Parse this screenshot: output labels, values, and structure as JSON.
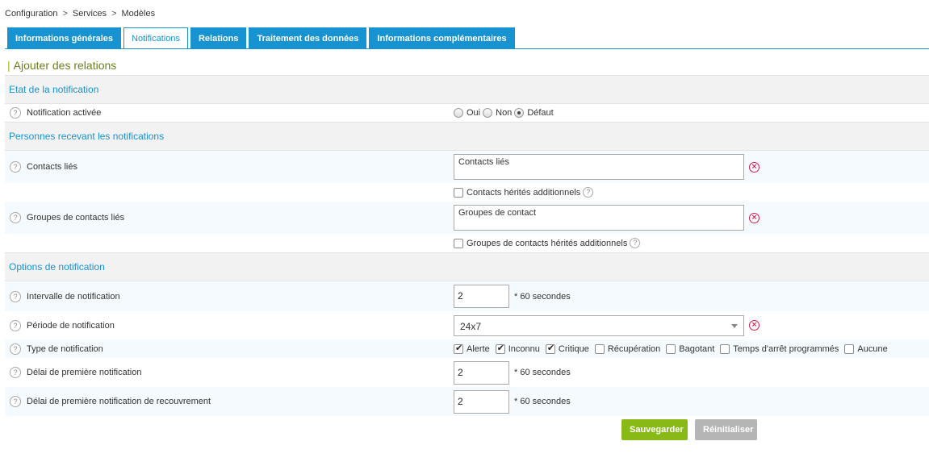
{
  "breadcrumb": [
    "Configuration",
    "Services",
    "Modèles"
  ],
  "breadcrumb_sep": ">",
  "tabs": [
    {
      "label": "Informations générales",
      "active": false
    },
    {
      "label": "Notifications",
      "active": true
    },
    {
      "label": "Relations",
      "active": false
    },
    {
      "label": "Traitement des données",
      "active": false
    },
    {
      "label": "Informations complémentaires",
      "active": false
    }
  ],
  "page_title": "Ajouter des relations",
  "help_glyph": "?",
  "clear_glyph": "×",
  "sections": {
    "etat": {
      "title": "Etat de la notification"
    },
    "personnes": {
      "title": "Personnes recevant les notifications"
    },
    "options": {
      "title": "Options de notification"
    }
  },
  "fields": {
    "notification_activee": {
      "label": "Notification activée",
      "options": [
        "Oui",
        "Non",
        "Défaut"
      ],
      "selected": "Défaut"
    },
    "contacts_lies": {
      "label": "Contacts liés",
      "placeholder": "Contacts liés"
    },
    "contacts_herites": {
      "label": "Contacts hérités additionnels",
      "checked": false
    },
    "groupes_contacts": {
      "label": "Groupes de contacts liés",
      "placeholder": "Groupes de contact"
    },
    "groupes_herites": {
      "label": "Groupes de contacts hérités additionnels",
      "checked": false
    },
    "intervalle": {
      "label": "Intervalle de notification",
      "value": "2",
      "unit": "* 60 secondes"
    },
    "periode": {
      "label": "Période de notification",
      "value": "24x7"
    },
    "type": {
      "label": "Type de notification",
      "options": [
        {
          "label": "Alerte",
          "checked": true
        },
        {
          "label": "Inconnu",
          "checked": true
        },
        {
          "label": "Critique",
          "checked": true
        },
        {
          "label": "Récupération",
          "checked": false
        },
        {
          "label": "Bagotant",
          "checked": false
        },
        {
          "label": "Temps d'arrêt programmés",
          "checked": false
        },
        {
          "label": "Aucune",
          "checked": false
        }
      ]
    },
    "delai_premiere": {
      "label": "Délai de première notification",
      "value": "2",
      "unit": "* 60 secondes"
    },
    "delai_recouvrement": {
      "label": "Délai de première notification de recouvrement",
      "value": "2",
      "unit": "* 60 secondes"
    }
  },
  "buttons": {
    "save": "Sauvegarder",
    "reset": "Réinitialiser"
  },
  "colors": {
    "accent": "#1793d1",
    "save": "#88b917",
    "reset": "#b5b5b5",
    "error": "#d81b4a",
    "title": "#6b7f20"
  }
}
